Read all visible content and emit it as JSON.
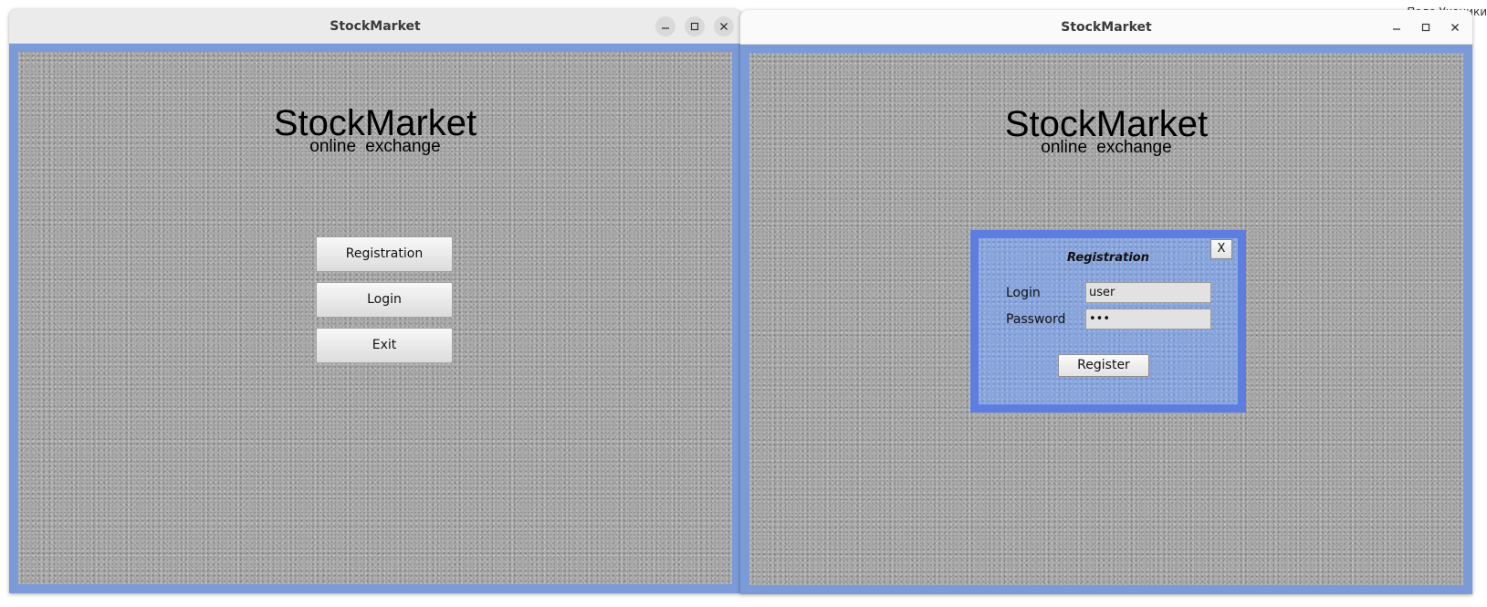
{
  "corner_text": "Поле Ученики",
  "windows": {
    "left": {
      "title": "StockMarket",
      "logo_title": "StockMarket",
      "logo_subtitle": "online  exchange",
      "menu": {
        "registration_label": "Registration",
        "login_label": "Login",
        "exit_label": "Exit"
      }
    },
    "right": {
      "title": "StockMarket",
      "logo_title": "StockMarket",
      "logo_subtitle": "online  exchange",
      "dialog": {
        "title": "Registration",
        "close_label": "X",
        "login_label": "Login",
        "login_value": "user",
        "password_label": "Password",
        "password_value": "•••",
        "register_label": "Register"
      }
    }
  },
  "colors": {
    "window_border": "#7a9bd8",
    "dialog_border": "#5d7ee0",
    "dialog_fill": "#87a4dd",
    "content_texture": "#a8a8a8"
  },
  "icons": {
    "minimize": "minimize-icon",
    "maximize": "maximize-icon",
    "close": "close-icon"
  }
}
